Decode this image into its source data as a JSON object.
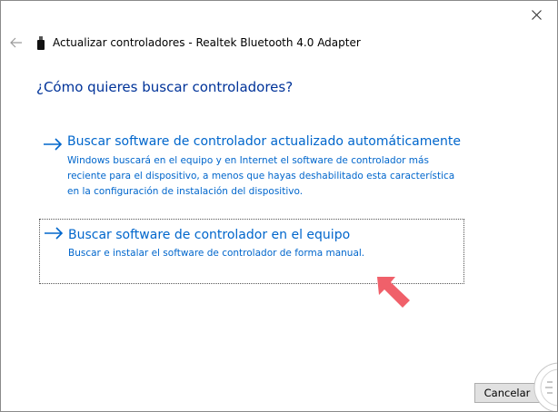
{
  "window": {
    "title": "Actualizar controladores - Realtek Bluetooth 4.0 Adapter"
  },
  "question": "¿Cómo quieres buscar controladores?",
  "options": [
    {
      "title": "Buscar software de controlador actualizado automáticamente",
      "description": "Windows buscará en el equipo y en Internet el software de controlador más reciente para el dispositivo, a menos que hayas deshabilitado esta característica en la configuración de instalación del dispositivo."
    },
    {
      "title": "Buscar software de controlador en el equipo",
      "description": "Buscar e instalar el software de controlador de forma manual."
    }
  ],
  "footer": {
    "cancel_label": "Cancelar"
  },
  "colors": {
    "link": "#0066cc",
    "heading": "#003399",
    "annotation_arrow": "#f0606a"
  },
  "icons": {
    "close": "close-icon",
    "back": "back-arrow-icon",
    "device": "usb-device-icon",
    "option_arrow": "arrow-right-icon",
    "annotation": "pointer-arrow-icon"
  }
}
